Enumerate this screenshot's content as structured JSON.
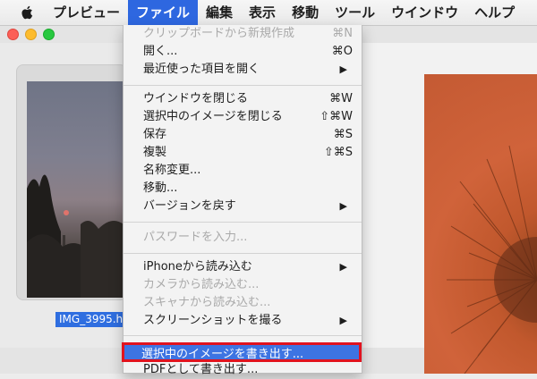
{
  "menubar": {
    "apple_icon": "apple-icon",
    "items": [
      "プレビュー",
      "ファイル",
      "編集",
      "表示",
      "移動",
      "ツール",
      "ウインドウ",
      "ヘルプ"
    ],
    "active_index": 1
  },
  "sidebar": {
    "filename": "IMG_3995.h"
  },
  "menu": {
    "items": [
      {
        "label": "クリップボードから新規作成",
        "shortcut": "⌘N",
        "enabled": false
      },
      {
        "label": "開く...",
        "shortcut": "⌘O",
        "enabled": true
      },
      {
        "label": "最近使った項目を開く",
        "shortcut": "▶",
        "enabled": true
      },
      {
        "label": "ウインドウを閉じる",
        "shortcut": "⌘W",
        "enabled": true
      },
      {
        "label": "選択中のイメージを閉じる",
        "shortcut": "⇧⌘W",
        "enabled": true
      },
      {
        "label": "保存",
        "shortcut": "⌘S",
        "enabled": true
      },
      {
        "label": "複製",
        "shortcut": "⇧⌘S",
        "enabled": true
      },
      {
        "label": "名称変更...",
        "shortcut": "",
        "enabled": true
      },
      {
        "label": "移動...",
        "shortcut": "",
        "enabled": true
      },
      {
        "label": "バージョンを戻す",
        "shortcut": "▶",
        "enabled": true
      },
      {
        "label": "パスワードを入力...",
        "shortcut": "",
        "enabled": false
      },
      {
        "label": "iPhoneから読み込む",
        "shortcut": "▶",
        "enabled": true
      },
      {
        "label": "カメラから読み込む...",
        "shortcut": "",
        "enabled": false
      },
      {
        "label": "スキャナから読み込む...",
        "shortcut": "",
        "enabled": false
      },
      {
        "label": "スクリーンショットを撮る",
        "shortcut": "▶",
        "enabled": true
      },
      {
        "label": "選択中のイメージを書き出す...",
        "shortcut": "",
        "enabled": true,
        "highlighted": true
      },
      {
        "label": "PDFとして書き出す...",
        "shortcut": "",
        "enabled": true
      }
    ]
  },
  "colors": {
    "highlight_border": "#e1131e",
    "menu_active": "#2e67e0"
  }
}
